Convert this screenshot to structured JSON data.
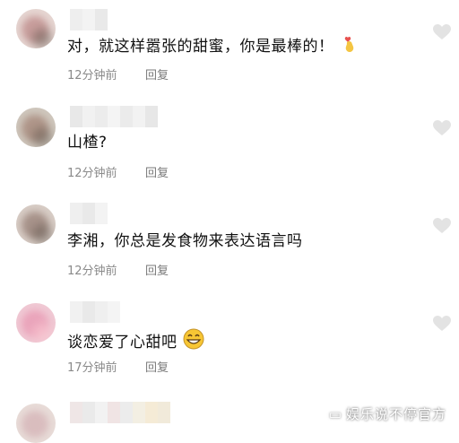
{
  "comments": [
    {
      "text": "对，就这样嚣张的甜蜜，你是最棒的！",
      "emoji": "finger-heart-emoji",
      "time": "12分钟前",
      "reply": "回复"
    },
    {
      "text": "山楂?",
      "time": "12分钟前",
      "reply": "回复"
    },
    {
      "text": "李湘，你总是发食物来表达语言吗",
      "time": "12分钟前",
      "reply": "回复"
    },
    {
      "text": "谈恋爱了心甜吧",
      "emoji": "grinning-face-emoji",
      "time": "17分钟前",
      "reply": "回复"
    }
  ],
  "watermark": {
    "text": "娱乐说不停官方"
  },
  "colors": {
    "meta": "#8a8a8a",
    "heart": "#e3e3e3",
    "text": "#111111"
  },
  "icons": {
    "like": "heart-icon"
  }
}
